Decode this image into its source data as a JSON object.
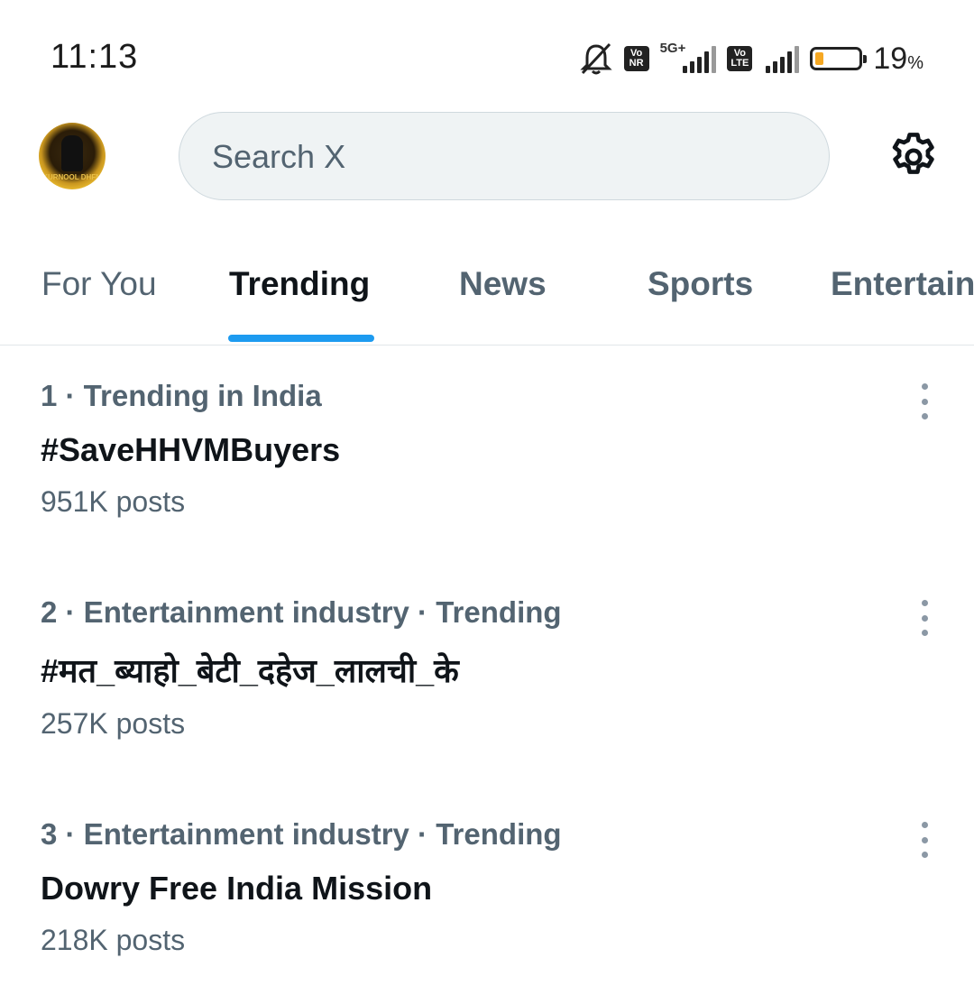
{
  "status_bar": {
    "time": "11:13",
    "network_label": "5G+",
    "chip1": [
      "Vo",
      "NR"
    ],
    "chip2": [
      "Vo",
      "LTE"
    ],
    "battery_percent": "19",
    "battery_unit": "%",
    "battery_level": 0.19,
    "battery_color": "#f6a823"
  },
  "header": {
    "avatar_text": "KURNOOL DHFM",
    "search_placeholder": "Search X",
    "settings_icon": "gear-icon"
  },
  "tabs": [
    {
      "label": "For You",
      "active": false
    },
    {
      "label": "Trending",
      "active": true
    },
    {
      "label": "News",
      "active": false
    },
    {
      "label": "Sports",
      "active": false
    },
    {
      "label": "Entertain",
      "active": false
    }
  ],
  "accent_color": "#1d9bf0",
  "trends": [
    {
      "meta": "1 · Trending in India",
      "title": "#SaveHHVMBuyers",
      "posts": "951K posts"
    },
    {
      "meta": "2 · Entertainment industry · Trending",
      "title": "#मत_ब्याहो_बेटी_दहेज_लालची_के",
      "posts": "257K posts"
    },
    {
      "meta": "3 · Entertainment industry · Trending",
      "title": "Dowry Free India Mission",
      "posts": "218K posts"
    }
  ]
}
